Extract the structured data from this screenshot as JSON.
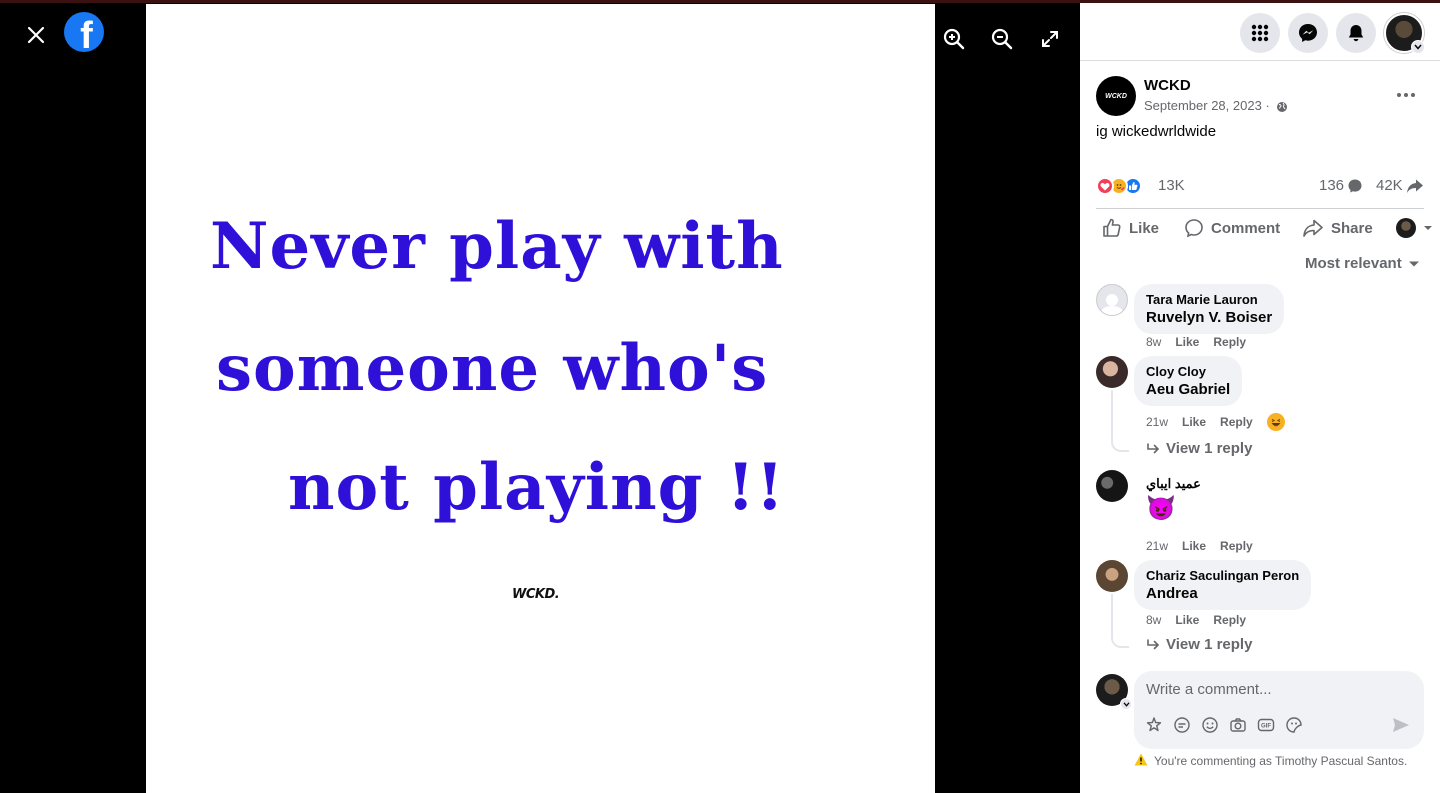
{
  "viewer": {
    "quote_lines": [
      "Never play with",
      "someone who's",
      "not playing !!"
    ],
    "signature": "WCKD."
  },
  "post": {
    "page_name": "WCKD",
    "date": "September 28, 2023 ·",
    "caption": "ig wickedwrldwide",
    "reaction_count": "13K",
    "comment_count": "136",
    "share_count": "42K"
  },
  "actions": {
    "like": "Like",
    "comment": "Comment",
    "share": "Share"
  },
  "sort_label": "Most relevant",
  "comments": [
    {
      "author": "Tara Marie Lauron",
      "text": "Ruvelyn V. Boiser",
      "time": "8w",
      "like": "Like",
      "reply": "Reply"
    },
    {
      "author": "Cloy Cloy",
      "text": "Aeu Gabriel",
      "time": "21w",
      "like": "Like",
      "reply": "Reply",
      "view_replies": "View 1 reply"
    },
    {
      "author": "عميد ايباي",
      "text": "😈",
      "time": "21w",
      "like": "Like",
      "reply": "Reply"
    },
    {
      "author": "Chariz Saculingan Peron",
      "text": "Andrea",
      "time": "8w",
      "like": "Like",
      "reply": "Reply",
      "view_replies": "View 1 reply"
    }
  ],
  "compose": {
    "placeholder": "Write a comment...",
    "notice": "You're commenting as Timothy Pascual Santos."
  },
  "colors": {
    "quote": "#2e10d8",
    "brand": "#1877f2"
  },
  "icons": [
    "close-icon",
    "facebook-logo",
    "zoom-in-icon",
    "zoom-out-icon",
    "fullscreen-icon",
    "menu-grid-icon",
    "messenger-icon",
    "bell-icon",
    "globe-icon",
    "more-icon",
    "like-icon",
    "comment-icon",
    "share-icon",
    "chevron-down-icon",
    "reply-arrow-icon",
    "sticker-icon",
    "emoji-icon",
    "camera-icon",
    "gif-icon",
    "send-icon",
    "warning-icon"
  ]
}
